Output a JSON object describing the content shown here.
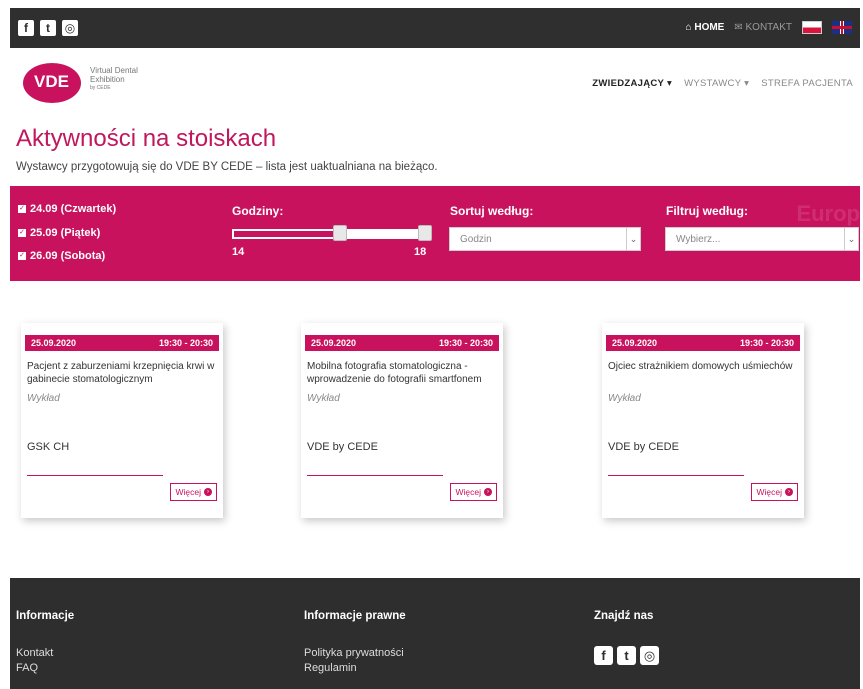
{
  "topbar": {
    "social_icons": [
      "facebook-icon",
      "twitter-icon",
      "instagram-icon"
    ],
    "home_label": "HOME",
    "kontakt_label": "KONTAKT",
    "home_glyph": "⌂",
    "kontakt_glyph": "✉",
    "lang_flags": [
      "pl-flag",
      "uk-flag"
    ]
  },
  "logo": {
    "mark": "VDE",
    "line1": "Virtual Dental",
    "line2": "Exhibition",
    "line3": "by CEDE"
  },
  "nav": {
    "items": [
      "ZWIEDZAJĄCY",
      "WYSTAWCY",
      "STREFA PACJENTA"
    ],
    "caret": "▾"
  },
  "page": {
    "title": "Aktywności na stoiskach",
    "subtitle": "Wystawcy przygotowują się do VDE BY CEDE – lista jest uaktualniana na bieżąco."
  },
  "filters": {
    "days": [
      "24.09  (Czwartek)",
      "25.09  (Piątek)",
      "26.09  (Sobota)"
    ],
    "hours_label": "Godziny:",
    "hours_min": "14",
    "hours_max": "18",
    "sort_label": "Sortuj według:",
    "sort_value": "Godzin",
    "filter_label": "Filtruj według:",
    "filter_value": "Wybierz...",
    "watermark": "Europ"
  },
  "cards": [
    {
      "date": "25.09.2020",
      "time": "19:30 - 20:30",
      "title": "Pacjent z zaburzeniami krzepnięcia krwi w gabinecie stomatologicznym",
      "type": "Wykład",
      "exhibitor": "GSK CH",
      "more": "Więcej"
    },
    {
      "date": "25.09.2020",
      "time": "19:30 - 20:30",
      "title": "Mobilna fotografia stomatologiczna - wprowadzenie do fotografii smartfonem",
      "type": "Wykład",
      "exhibitor": "VDE by CEDE",
      "more": "Więcej"
    },
    {
      "date": "25.09.2020",
      "time": "19:30 - 20:30",
      "title": "Ojciec strażnikiem domowych uśmiechów",
      "type": "Wykład",
      "exhibitor": "VDE by CEDE",
      "more": "Więcej"
    }
  ],
  "footer": {
    "col1_head": "Informacje",
    "col1_links": [
      "Kontakt",
      "FAQ"
    ],
    "col2_head": "Informacje prawne",
    "col2_links": [
      "Polityka prywatności",
      "Regulamin"
    ],
    "col3_head": "Znajdź nas",
    "social_icons": [
      "facebook-icon",
      "twitter-icon",
      "instagram-icon"
    ]
  },
  "colors": {
    "brand": "#c8125e",
    "dark": "#2f2f2f"
  }
}
